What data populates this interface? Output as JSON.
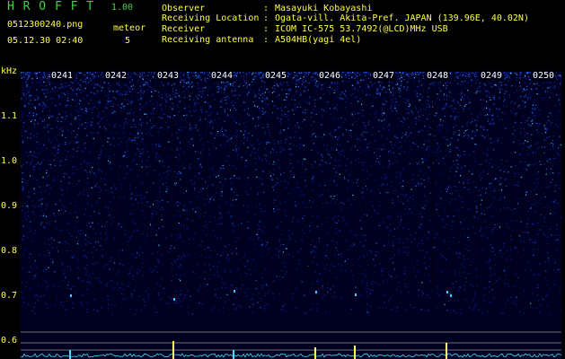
{
  "header": {
    "app_title": "H R O F F T",
    "app_version": "1.00",
    "file_name": "0512300240.png",
    "datetime": "05.12.30 02:40",
    "meteor_label": "meteor",
    "meteor_count": "5"
  },
  "info": [
    {
      "label": "Observer",
      "value": "Masayuki Kobayashi"
    },
    {
      "label": "Receiving Location",
      "value": "Ogata-vill. Akita-Pref. JAPAN (139.96E, 40.02N)"
    },
    {
      "label": "Receiver",
      "value": "ICOM IC-575 53.7492(@LCD)MHz USB"
    },
    {
      "label": "Receiving antenna",
      "value": "A504HB(yagi 4el)"
    }
  ],
  "info_separator": ":",
  "spectrogram": {
    "y_unit": "kHz",
    "y_ticks": [
      "1.1",
      "1.0",
      "0.9",
      "0.8",
      "0.7",
      "0.6"
    ],
    "time_ticks": [
      "0241",
      "0242",
      "0243",
      "0244",
      "0245",
      "0246",
      "0247",
      "0248",
      "0249",
      "0250"
    ],
    "colors": {
      "background": "#000020",
      "noise_low": "#1020a0",
      "noise_mid": "#2060e0",
      "noise_high": "#40c8ff",
      "meteor_trace": "#ffff60",
      "trace_line": "#40e0ff"
    }
  }
}
